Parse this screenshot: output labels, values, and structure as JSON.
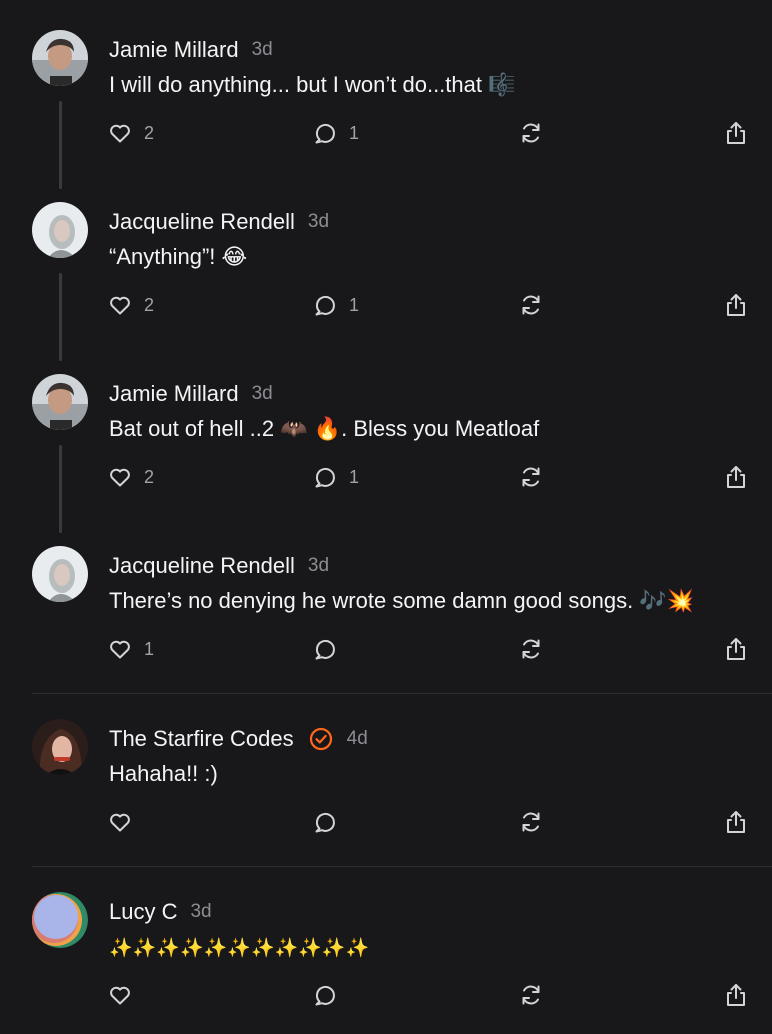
{
  "comments": [
    {
      "author": "Jamie Millard",
      "time": "3d",
      "text": "I will do anything... but I won’t do...that 🎼",
      "likes": "2",
      "replies": "1",
      "avatar_icon": "man-photo-avatar"
    },
    {
      "author": "Jacqueline Rendell",
      "time": "3d",
      "text": "“Anything”! 😂",
      "likes": "2",
      "replies": "1",
      "avatar_icon": "woman-photo-avatar"
    },
    {
      "author": "Jamie Millard",
      "time": "3d",
      "text": "Bat out of hell ..2 🦇 🔥. Bless you Meatloaf",
      "likes": "2",
      "replies": "1",
      "avatar_icon": "man-photo-avatar"
    },
    {
      "author": "Jacqueline Rendell",
      "time": "3d",
      "text": "There’s no denying he wrote some damn good songs. 🎶💥",
      "likes": "1",
      "replies": "",
      "avatar_icon": "woman-photo-avatar"
    },
    {
      "author": "The Starfire Codes",
      "time": "4d",
      "text": "Hahaha!! :)",
      "likes": "",
      "replies": "",
      "verified": true,
      "avatar_icon": "woman-dark-hair-avatar"
    },
    {
      "author": "Lucy C",
      "time": "3d",
      "text": "✨✨✨✨✨✨✨✨✨✨✨",
      "likes": "",
      "replies": "",
      "avatar_icon": "gradient-circle-avatar"
    }
  ],
  "icons": {
    "like": "heart-icon",
    "reply": "speech-bubble-icon",
    "restack": "restack-arrows-icon",
    "share": "share-upload-icon",
    "verified": "verified-check-icon"
  },
  "colors": {
    "background": "#18181b",
    "text": "#f4f4f5",
    "muted": "#8c8c92",
    "verified_accent": "#ff6719",
    "thread_line": "#3a3a3e"
  }
}
